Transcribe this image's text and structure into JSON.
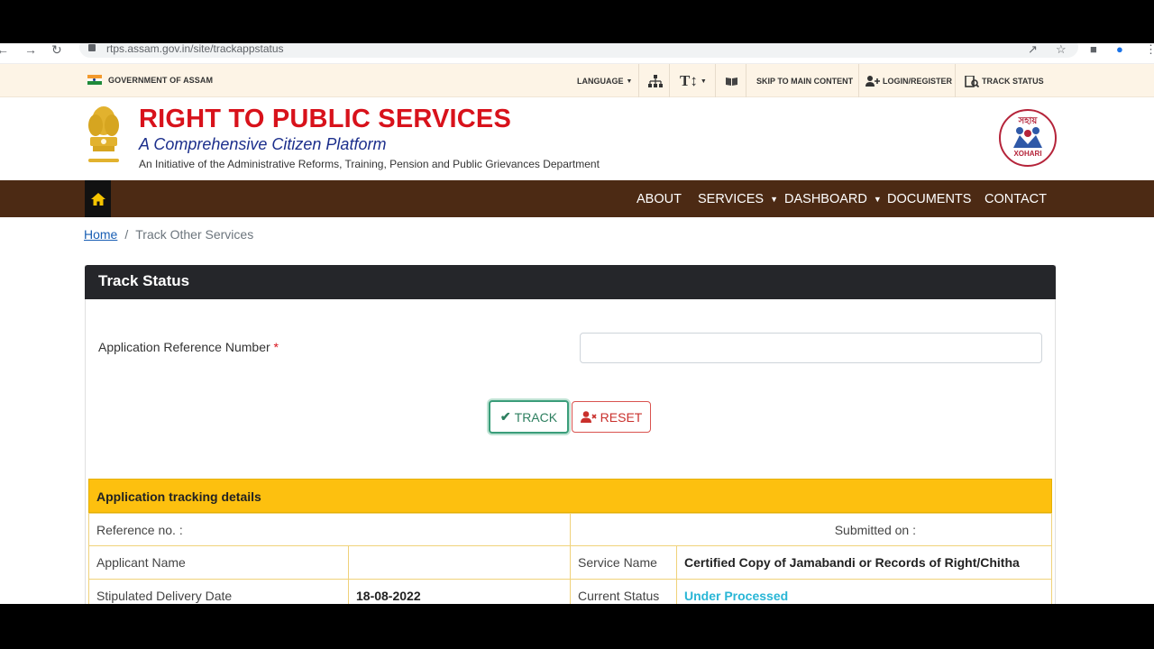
{
  "browser": {
    "url": "rtps.assam.gov.in/site/trackappstatus",
    "back_icon": "arrow-left",
    "forward_icon": "arrow-right",
    "reload_icon": "reload"
  },
  "topbar": {
    "gov_label": "GOVERNMENT OF ASSAM",
    "language_label": "LANGUAGE",
    "skip_label": "SKIP TO MAIN CONTENT",
    "login_label": "LOGIN/REGISTER",
    "track_label": "TRACK STATUS"
  },
  "header": {
    "title": "RIGHT TO PUBLIC SERVICES",
    "subtitle": "A Comprehensive Citizen Platform",
    "initiative": "An Initiative of the Administrative Reforms, Training, Pension and Public Grievances Department",
    "logo_top": "সহায়",
    "logo_bottom": "XOHARI"
  },
  "nav": {
    "items": [
      {
        "label": "ABOUT",
        "dropdown": false
      },
      {
        "label": "SERVICES",
        "dropdown": true
      },
      {
        "label": "DASHBOARD",
        "dropdown": true
      },
      {
        "label": "DOCUMENTS",
        "dropdown": false
      },
      {
        "label": "CONTACT",
        "dropdown": false
      }
    ]
  },
  "breadcrumb": {
    "home": "Home",
    "current": "Track Other Services"
  },
  "form": {
    "card_title": "Track Status",
    "ref_label": "Application Reference Number",
    "required_mark": "*",
    "ref_value": "",
    "track_label": "TRACK",
    "reset_label": "RESET"
  },
  "tracking": {
    "heading": "Application tracking details",
    "reference_label": "Reference no. :",
    "submitted_label": "Submitted on :",
    "applicant_label": "Applicant Name",
    "applicant_value": "",
    "service_label": "Service Name",
    "service_value": "Certified Copy of Jamabandi or Records of Right/Chitha",
    "delivery_label": "Stipulated Delivery Date",
    "delivery_value": "18-08-2022",
    "status_label": "Current Status",
    "status_value": "Under Processed"
  },
  "colors": {
    "brand_red": "#d8121b",
    "brand_blue": "#1c2f8c",
    "nav_brown": "#4c2a14",
    "table_yellow": "#fdc00f",
    "status_cyan": "#29b6d6"
  }
}
